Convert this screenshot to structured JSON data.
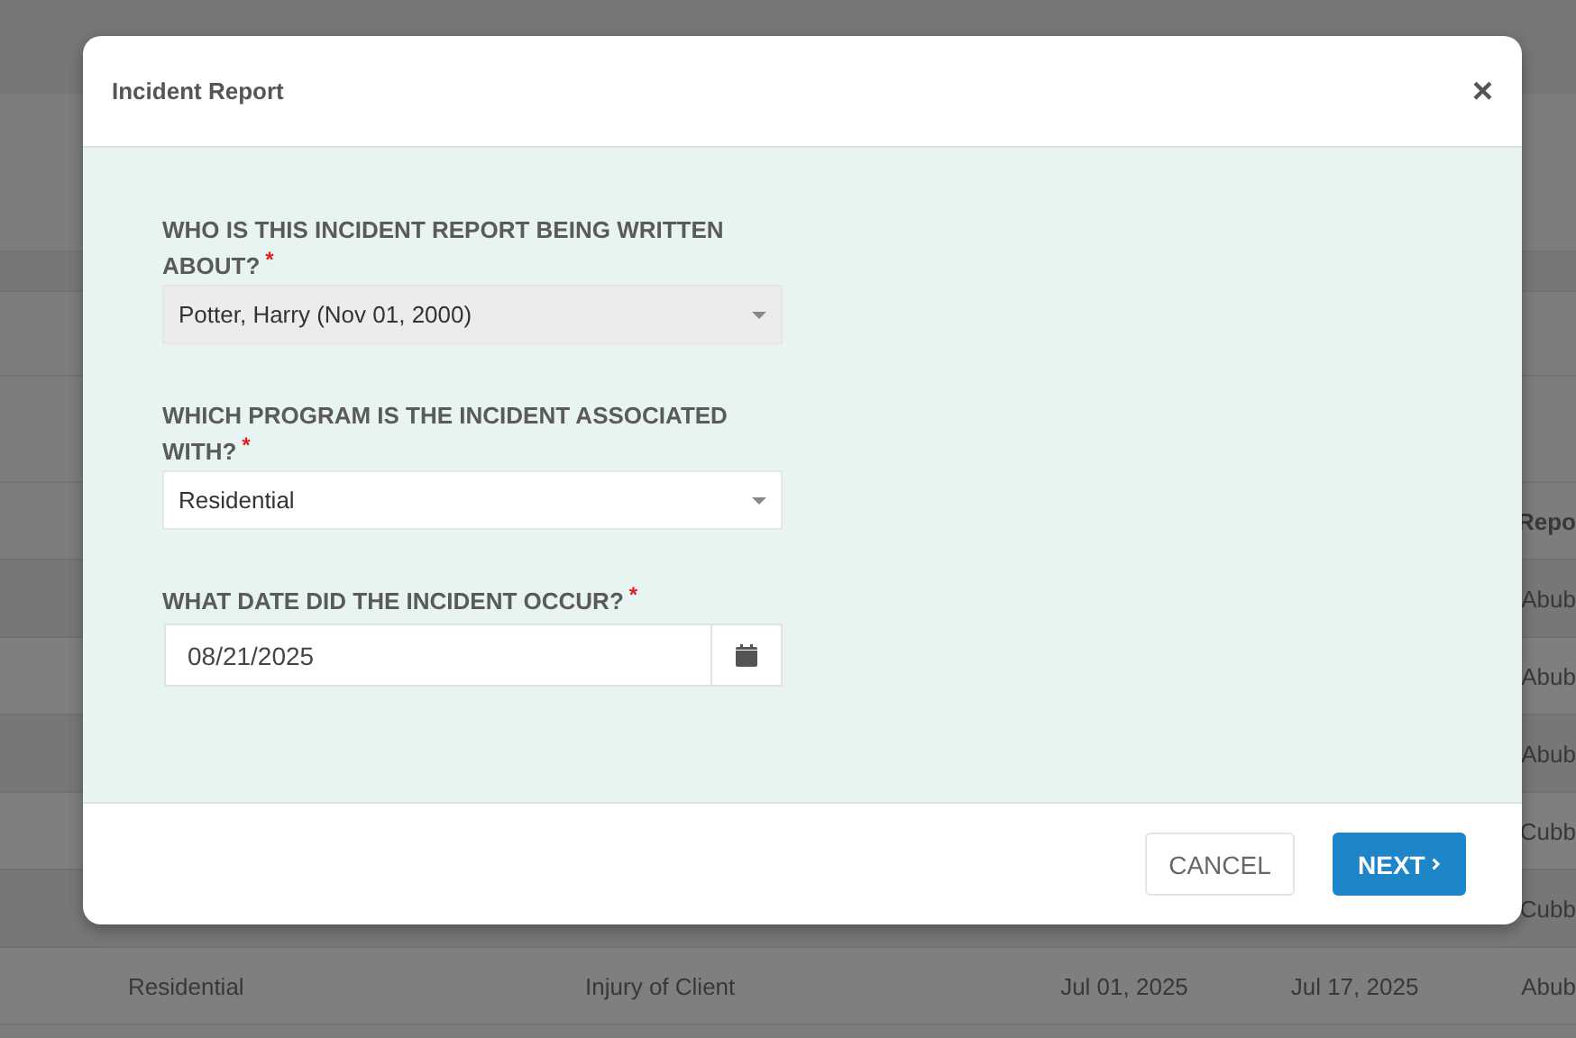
{
  "background_table": {
    "header": {
      "column_5": "Repo"
    },
    "rows": [
      {
        "column_5": "Abub"
      },
      {
        "column_5": "Abub"
      },
      {
        "column_5": "Abub"
      },
      {
        "column_5": "Cubb"
      },
      {
        "column_5": "Cubb"
      },
      {
        "program": "Residential",
        "incident_type": "Injury of Client",
        "date_1": "Jul 01, 2025",
        "date_2": "Jul 17, 2025",
        "column_5": "Abub"
      }
    ]
  },
  "modal": {
    "title": "Incident Report",
    "close": "×",
    "fields": [
      {
        "kind": "select",
        "label": "WHO IS THIS INCIDENT REPORT BEING WRITTEN ABOUT?",
        "required_mark": "*",
        "value": "Potter, Harry (Nov 01, 2000)",
        "disabled": true
      },
      {
        "kind": "select",
        "label": "WHICH PROGRAM IS THE INCIDENT ASSOCIATED WITH?",
        "required_mark": "*",
        "value": "Residential",
        "disabled": false
      },
      {
        "kind": "date",
        "label": "WHAT DATE DID THE INCIDENT OCCUR?",
        "required_mark": "*",
        "value": "08/21/2025",
        "disabled": false
      }
    ],
    "buttons": [
      {
        "kind": "cancel",
        "label": "CANCEL"
      },
      {
        "kind": "next",
        "label": "NEXT"
      }
    ]
  }
}
